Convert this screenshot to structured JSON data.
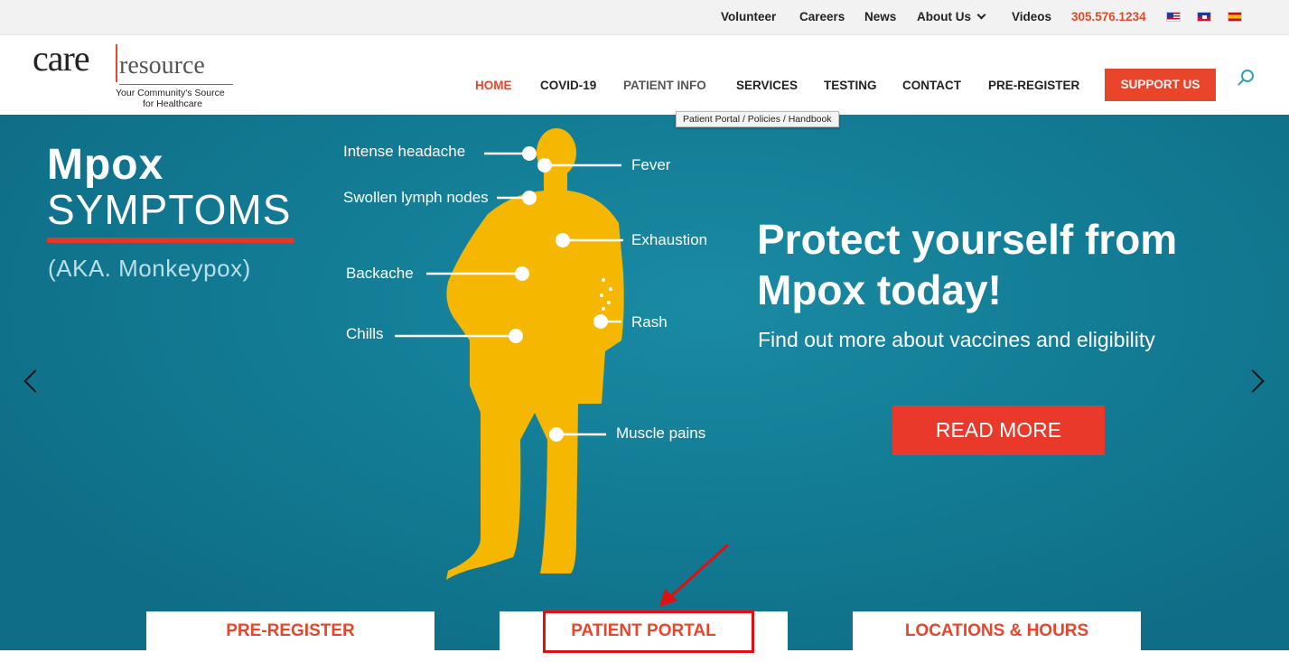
{
  "topbar": {
    "links": [
      "Volunteer",
      "Careers",
      "News",
      "About Us",
      "Videos"
    ],
    "phone": "305.576.1234",
    "flags": [
      "us-flag-icon",
      "haiti-flag-icon",
      "spain-flag-icon"
    ]
  },
  "logo": {
    "care": "care",
    "resource": "resource",
    "tagline_1": "Your Community's Source",
    "tagline_2": "for Healthcare"
  },
  "nav": {
    "items": [
      "HOME",
      "COVID-19",
      "PATIENT INFO",
      "SERVICES",
      "TESTING",
      "CONTACT",
      "PRE-REGISTER"
    ],
    "support": "SUPPORT US",
    "tooltip": "Patient Portal / Policies / Handbook"
  },
  "hero": {
    "title1": "Mpox",
    "title2": "SYMPTOMS",
    "aka": "(AKA. Monkeypox)",
    "symptoms": [
      "Intense headache",
      "Fever",
      "Swollen lymph nodes",
      "Exhaustion",
      "Backache",
      "Rash",
      "Chills",
      "Muscle pains"
    ],
    "promo_line1": "Protect yourself from",
    "promo_line2": "Mpox today!",
    "promo_sub": "Find out more about vaccines and eligibility",
    "cta": "READ MORE"
  },
  "quick_links": [
    "PRE-REGISTER",
    "PATIENT PORTAL",
    "LOCATIONS & HOURS"
  ],
  "colors": {
    "accent": "#e8452b",
    "hero_bg": "#137c95",
    "figure": "#f5b700",
    "annotation": "#e01010"
  }
}
